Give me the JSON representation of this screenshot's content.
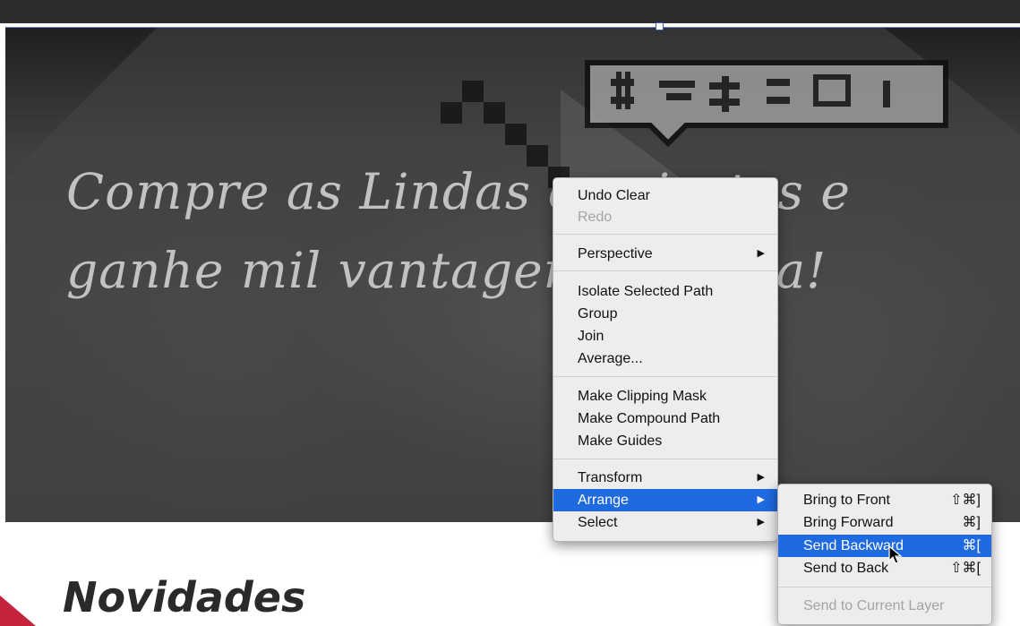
{
  "canvas": {
    "headline_line1": "Compre as Lindas camisetas e",
    "headline_line2": "ganhe mil vantagens na vida!",
    "section_title": "Novidades",
    "accent_color": "#c3243b"
  },
  "context_menu": {
    "items": [
      {
        "label": "Undo Clear"
      },
      {
        "label": "Redo",
        "disabled": true
      },
      {
        "label": "Perspective",
        "submenu": true
      },
      {
        "label": "Isolate Selected Path"
      },
      {
        "label": "Group"
      },
      {
        "label": "Join"
      },
      {
        "label": "Average..."
      },
      {
        "label": "Make Clipping Mask"
      },
      {
        "label": "Make Compound Path"
      },
      {
        "label": "Make Guides"
      },
      {
        "label": "Transform",
        "submenu": true
      },
      {
        "label": "Arrange",
        "submenu": true,
        "active": true
      },
      {
        "label": "Select",
        "submenu": true
      }
    ],
    "submenu_arrow": "▶",
    "highlight_color": "#1f6ae0"
  },
  "arrange_submenu": {
    "items": [
      {
        "label": "Bring to Front",
        "shortcut": "⇧⌘]"
      },
      {
        "label": "Bring Forward",
        "shortcut": "⌘]"
      },
      {
        "label": "Send Backward",
        "shortcut": "⌘[",
        "active": true
      },
      {
        "label": "Send to Back",
        "shortcut": "⇧⌘["
      },
      {
        "label": "Send to Current Layer",
        "disabled": true
      }
    ]
  },
  "icons": {
    "cursor": "arrow-cursor-icon"
  }
}
